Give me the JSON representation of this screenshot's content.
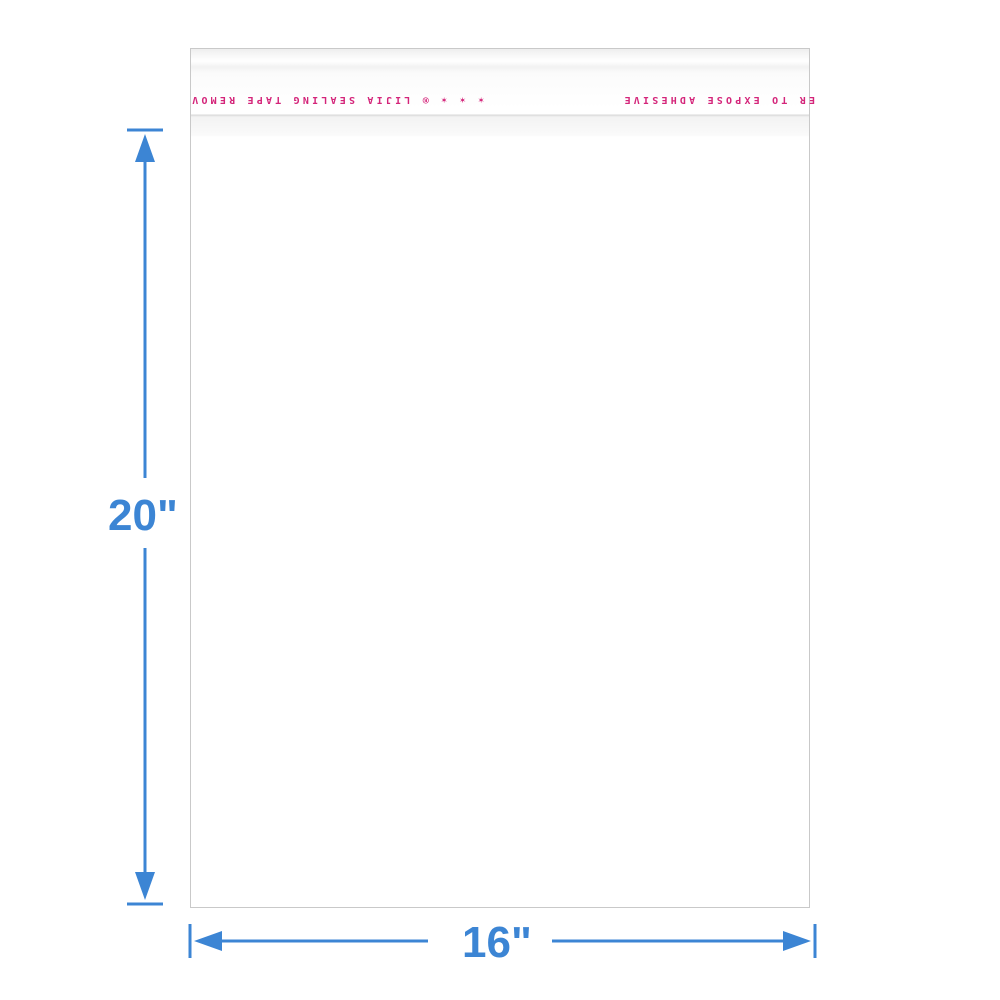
{
  "product": {
    "flap_text_left": "ER TO EXPOSE ADHESIVE",
    "flap_text_right": "✶ ✶ ✶ ® LIJIA SEALING TAPE REMOV"
  },
  "dimensions": {
    "height_label": "20\"",
    "width_label": "16\"",
    "arrow_color": "#3c85d4",
    "print_color": "#d4257a"
  }
}
